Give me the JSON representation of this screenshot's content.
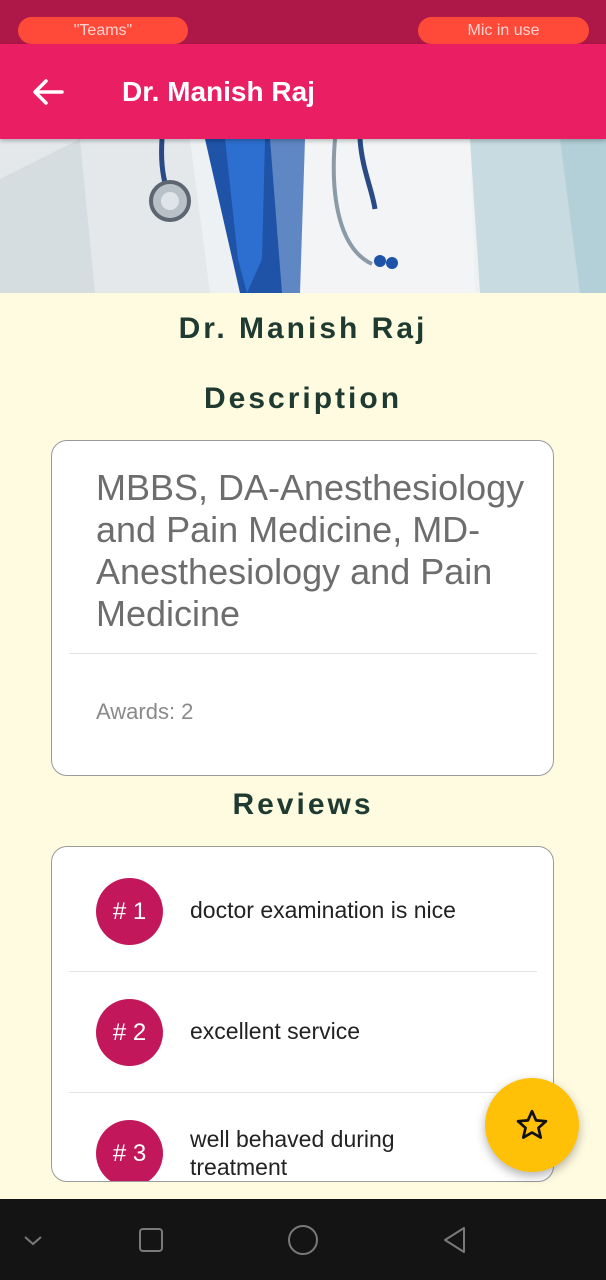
{
  "status_bar": {
    "left_pill": "\"Teams\"",
    "right_pill": "Mic in use"
  },
  "app_bar": {
    "title": "Dr. Manish Raj",
    "back_icon": "arrow-left-icon"
  },
  "profile": {
    "name": "Dr. Manish Raj",
    "description_heading": "Description",
    "description_text": "MBBS, DA-Anesthesiology and Pain Medicine, MD-Anesthesiology and Pain Medicine",
    "awards": "Awards: 2",
    "reviews_heading": "Reviews"
  },
  "reviews": [
    {
      "rank": "# 1",
      "text": "doctor examination is nice"
    },
    {
      "rank": "# 2",
      "text": "excellent service"
    },
    {
      "rank": "# 3",
      "text": "well behaved during treatment"
    }
  ],
  "fab": {
    "icon": "star-outline-icon"
  },
  "colors": {
    "status_bar": "#ad1848",
    "app_bar": "#e91e63",
    "badge": "#c2185b",
    "fab": "#ffc107",
    "background": "#fffbe1"
  }
}
